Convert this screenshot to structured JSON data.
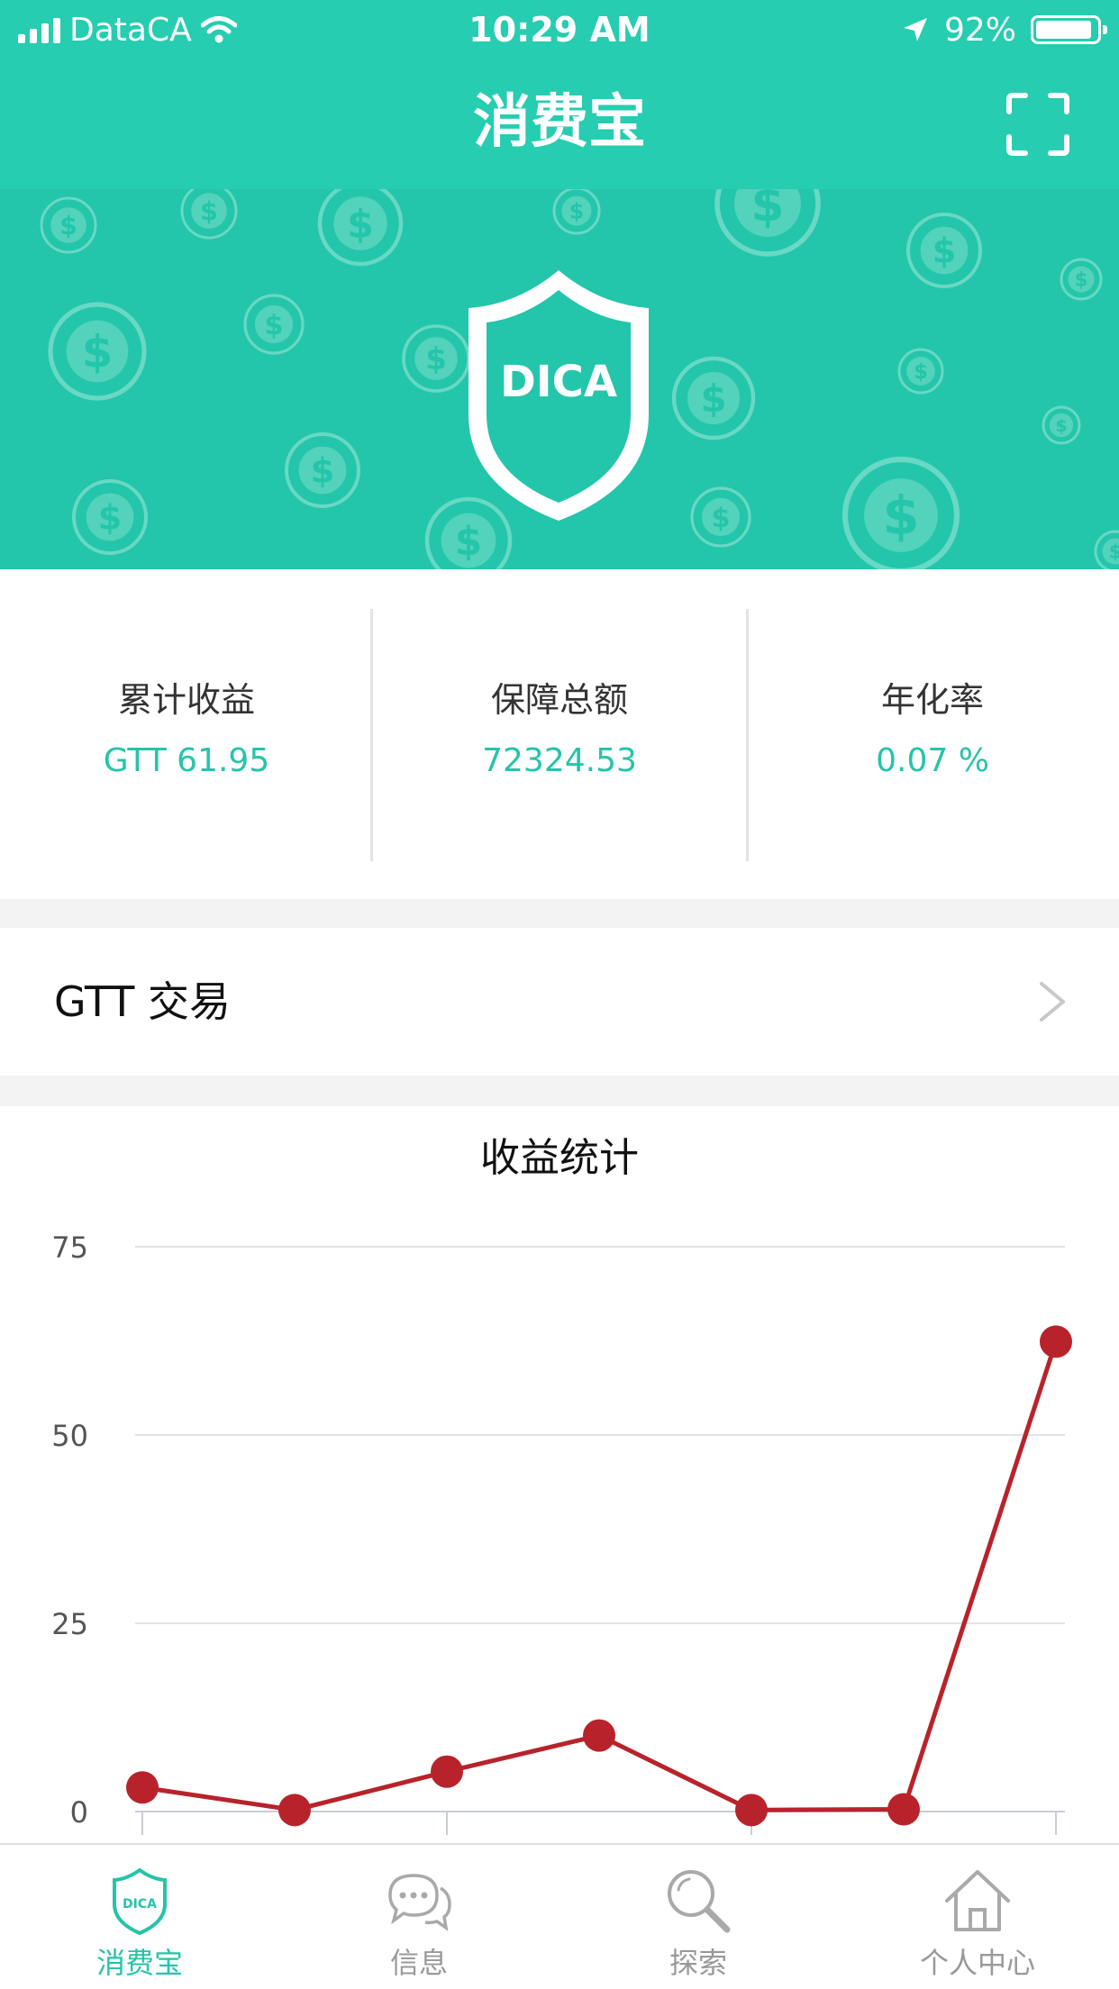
{
  "status_bar": {
    "carrier": "DataCA",
    "time": "10:29 AM",
    "battery": "92%",
    "battery_level": 0.92
  },
  "nav": {
    "title": "消费宝",
    "scan_icon": "scan-icon"
  },
  "banner": {
    "shield_text": "DICA"
  },
  "stats": [
    {
      "label": "累计收益",
      "value": "GTT 61.95"
    },
    {
      "label": "保障总额",
      "value": "72324.53"
    },
    {
      "label": "年化率",
      "value": "0.07 %"
    }
  ],
  "trade": {
    "label": "GTT 交易",
    "chevron_icon": "chevron-right-icon"
  },
  "chart_data": {
    "type": "line",
    "title": "收益统计",
    "yticks": [
      "75",
      "50",
      "25",
      "0"
    ],
    "ylim": [
      0,
      75
    ],
    "grid": true,
    "series": [
      {
        "values": [
          3.2,
          0.2,
          5.3,
          10.1,
          0.2,
          0.3,
          62.4
        ]
      }
    ],
    "colors": {
      "line": "#b8232b",
      "grid": "#e1e3e8",
      "axis": "#c9cdd8"
    }
  },
  "tabs": [
    {
      "label": "消费宝",
      "icon": "dica-shield-icon",
      "active": true
    },
    {
      "label": "信息",
      "icon": "chat-bubbles-icon",
      "active": false
    },
    {
      "label": "探索",
      "icon": "search-icon",
      "active": false
    },
    {
      "label": "个人中心",
      "icon": "home-icon",
      "active": false
    }
  ],
  "colors": {
    "brand": "#26cdb0",
    "accent_text": "#26c4a8",
    "inactive": "#999999"
  }
}
